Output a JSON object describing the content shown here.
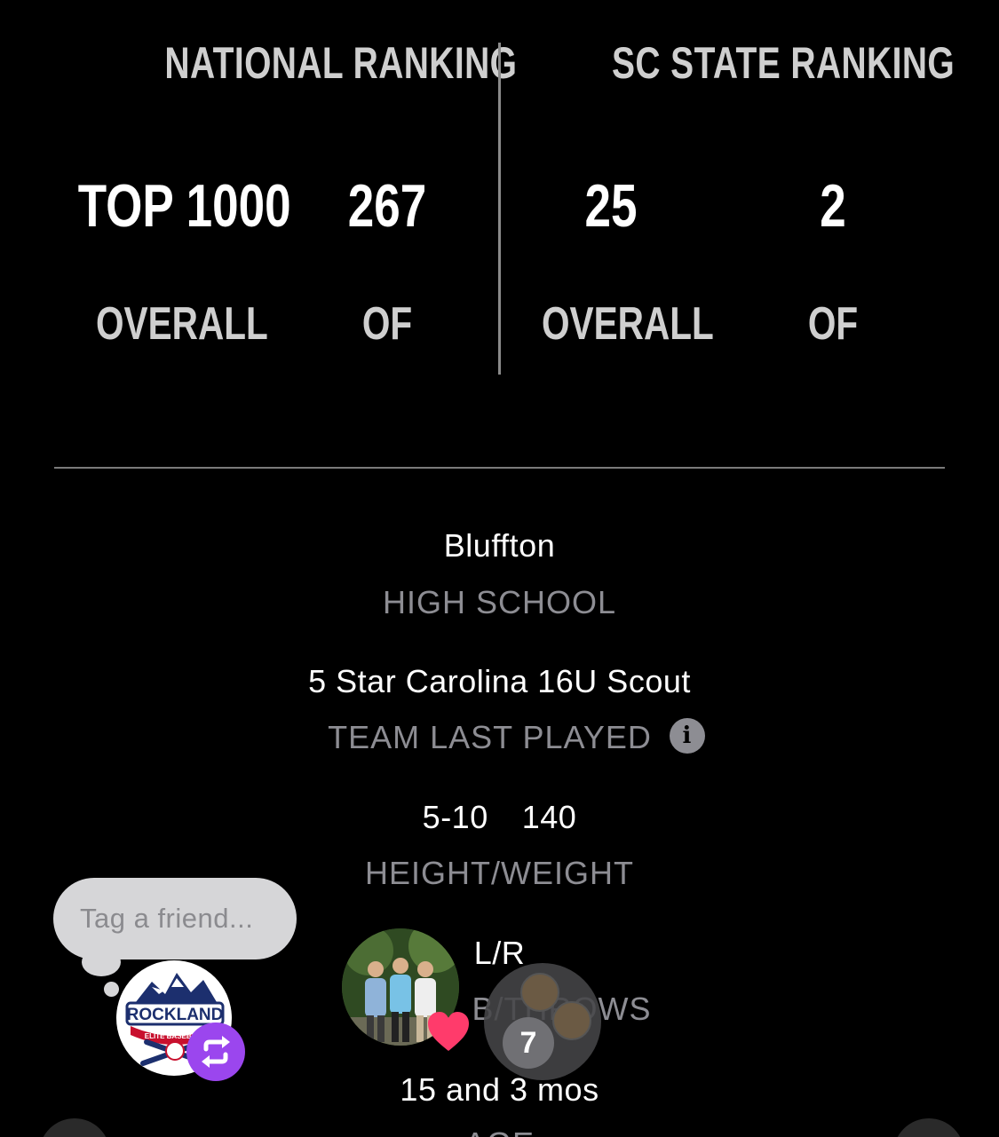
{
  "rankings": {
    "national": {
      "header": "NATIONAL RANKING",
      "overall_value": "TOP 1000",
      "overall_label": "OVERALL",
      "position_value": "267",
      "position_label": "OF"
    },
    "state": {
      "header": "SC STATE RANKING",
      "overall_value": "25",
      "overall_label": "OVERALL",
      "position_value": "2",
      "position_label": "OF"
    }
  },
  "profile": {
    "high_school": {
      "value": "Bluffton",
      "label": "HIGH SCHOOL"
    },
    "team": {
      "value": "5 Star Carolina 16U Scout",
      "label": "TEAM LAST PLAYED"
    },
    "height": "5-10",
    "weight": "140",
    "height_weight_label": "HEIGHT/WEIGHT",
    "bats_throws": {
      "value": "L/R",
      "label": "B/THROWS"
    },
    "age": {
      "value": "15 and 3 mos",
      "label": "AGE"
    }
  },
  "overlay": {
    "tag_placeholder": "Tag a friend...",
    "logo_text": "ROCKLAND",
    "logo_subtext": "ELITE BASEBALL",
    "tagged_count": "7"
  },
  "colors": {
    "background": "#000000",
    "label_gray": "#8d8d93",
    "repost_purple": "#9b46ee",
    "heart_pink": "#ff3b6b"
  }
}
